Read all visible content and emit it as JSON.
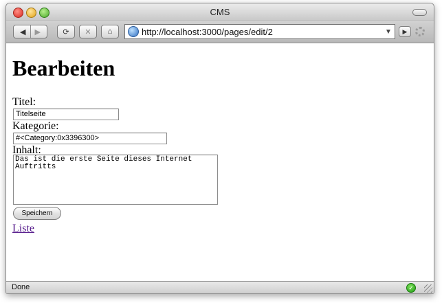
{
  "window": {
    "title": "CMS"
  },
  "toolbar": {
    "back_icon": "back-arrow-icon",
    "forward_icon": "forward-arrow-icon",
    "reload_icon": "reload-icon",
    "stop_icon": "stop-icon",
    "home_icon": "home-icon",
    "url": "http://localhost:3000/pages/edit/2"
  },
  "page": {
    "heading": "Bearbeiten",
    "title_label": "Titel:",
    "title_value": "Titelseite",
    "category_label": "Kategorie:",
    "category_value": "#<Category:0x3396300>",
    "content_label": "Inhalt:",
    "content_value": "Das ist die erste Seite dieses Internet Auftritts",
    "save_button": "Speichern",
    "list_link": "Liste"
  },
  "status": {
    "text": "Done"
  },
  "colors": {
    "link_visited": "#551a8b",
    "status_ok": "#1e9a12"
  }
}
